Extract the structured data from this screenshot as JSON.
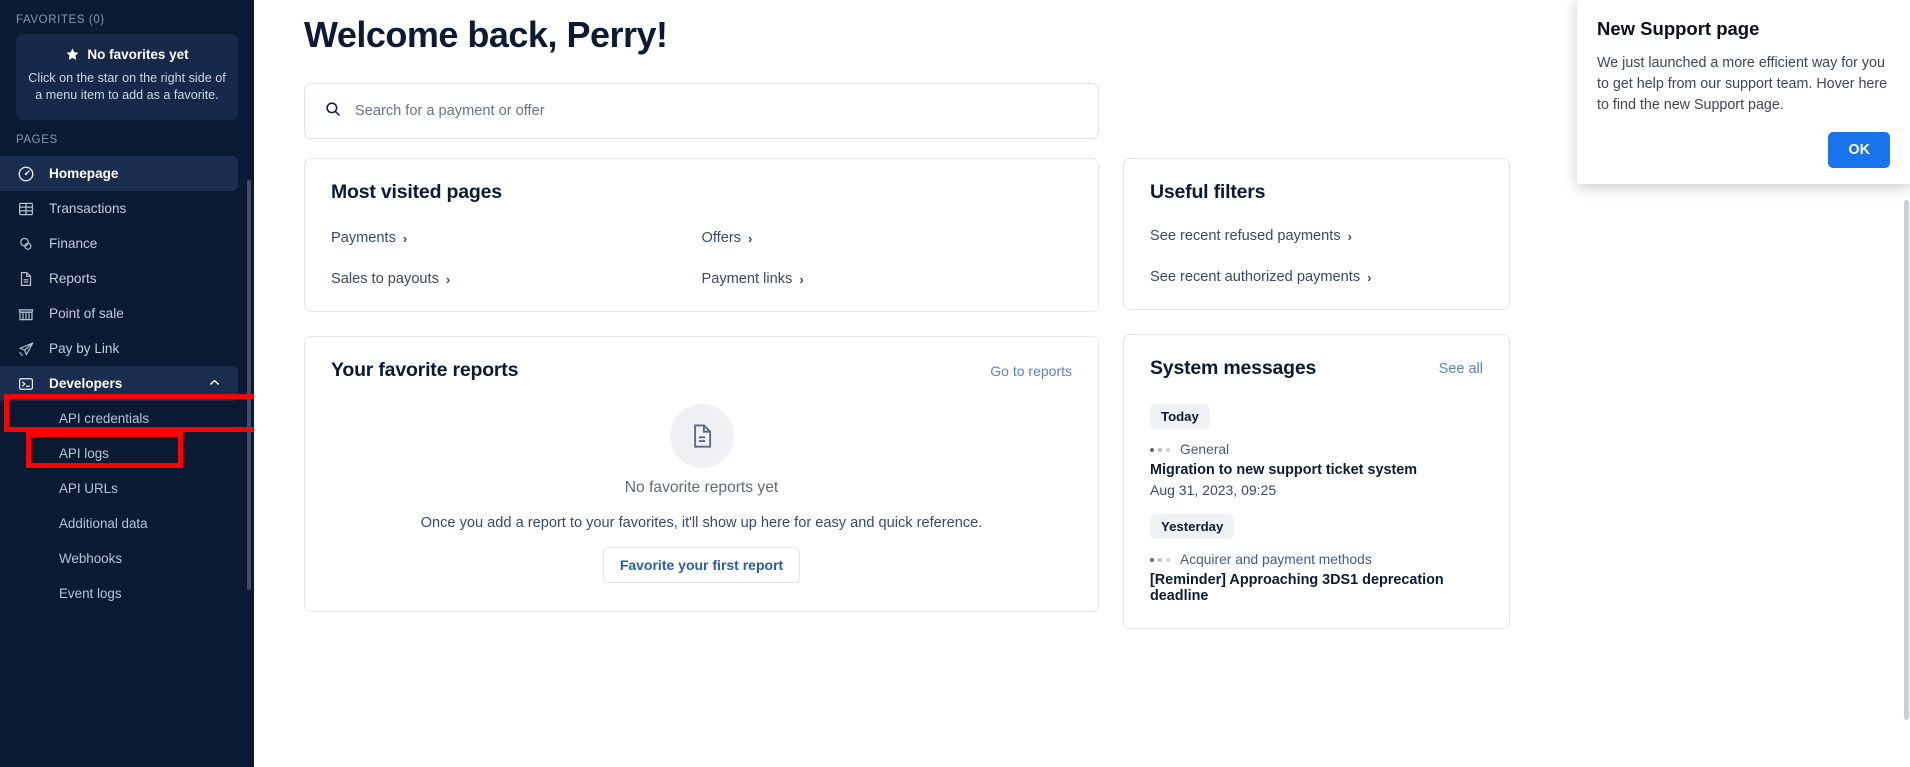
{
  "sidebar": {
    "favorites_label": "FAVORITES (0)",
    "favorites_empty_title": "No favorites yet",
    "favorites_empty_desc": "Click on the star on the right side of a menu item to add as a favorite.",
    "pages_label": "PAGES",
    "items": [
      {
        "label": "Homepage",
        "icon": "homepage-icon",
        "active": true
      },
      {
        "label": "Transactions",
        "icon": "table-icon",
        "active": false
      },
      {
        "label": "Finance",
        "icon": "coins-icon",
        "active": false
      },
      {
        "label": "Reports",
        "icon": "document-icon",
        "active": false
      },
      {
        "label": "Point of sale",
        "icon": "storefront-icon",
        "active": false
      },
      {
        "label": "Pay by Link",
        "icon": "paper-plane-icon",
        "active": false
      },
      {
        "label": "Developers",
        "icon": "terminal-icon",
        "active": true
      }
    ],
    "developers_sub_items": [
      {
        "label": "API credentials"
      },
      {
        "label": "API logs"
      },
      {
        "label": "API URLs"
      },
      {
        "label": "Additional data"
      },
      {
        "label": "Webhooks"
      },
      {
        "label": "Event logs"
      }
    ],
    "annotation_color": "#fe0000"
  },
  "main": {
    "greeting": "Welcome back, Perry!",
    "search": {
      "placeholder": "Search for a payment or offer",
      "value": ""
    },
    "most_visited": {
      "title": "Most visited pages",
      "links": [
        "Payments",
        "Offers",
        "Sales to payouts",
        "Payment links"
      ]
    },
    "favorite_reports": {
      "title": "Your favorite reports",
      "go_to_reports": "Go to reports",
      "empty_title": "No favorite reports yet",
      "empty_desc": "Once you add a report to your favorites, it'll show up here for easy and quick reference.",
      "cta": "Favorite your first report"
    },
    "useful_filters": {
      "title": "Useful filters",
      "links": [
        "See recent refused payments",
        "See recent authorized payments"
      ]
    },
    "system_messages": {
      "title": "System messages",
      "see_all": "See all",
      "groups": [
        {
          "day": "Today",
          "messages": [
            {
              "category": "General",
              "title": "Migration to new support ticket system",
              "date": "Aug 31, 2023, 09:25"
            }
          ]
        },
        {
          "day": "Yesterday",
          "messages": [
            {
              "category": "Acquirer and payment methods",
              "title": "[Reminder] Approaching 3DS1 deprecation deadline",
              "date": ""
            }
          ]
        }
      ]
    }
  },
  "popup": {
    "title": "New Support page",
    "body": "We just launched a more efficient way for you to get help from our support team. Hover here to find the new Support page.",
    "ok_label": "OK",
    "accent_color": "#1774ed"
  }
}
